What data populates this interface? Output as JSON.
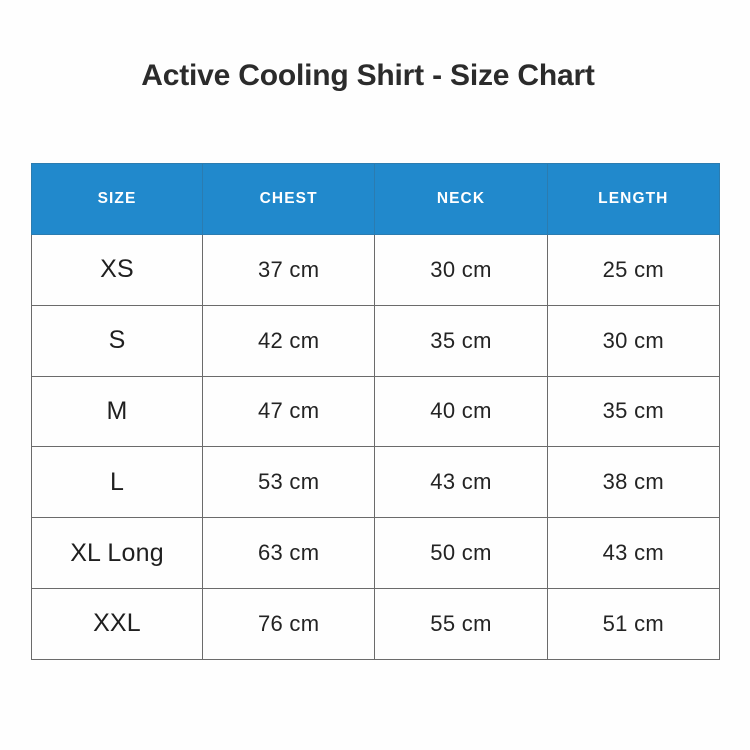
{
  "page": {
    "title": "Active Cooling Shirt - Size Chart",
    "background_color": "#fefefe",
    "accent_color": "#2189cc",
    "border_color": "#6b6b6b",
    "text_color": "#2b2b2b"
  },
  "chart_data": {
    "type": "table",
    "title": "Active Cooling Shirt - Size Chart",
    "columns": [
      "SIZE",
      "CHEST",
      "NECK",
      "LENGTH"
    ],
    "rows": [
      [
        "XS",
        "37 cm",
        "30 cm",
        "25 cm"
      ],
      [
        "S",
        "42 cm",
        "35 cm",
        "30 cm"
      ],
      [
        "M",
        "47 cm",
        "40 cm",
        "35 cm"
      ],
      [
        "L",
        "53 cm",
        "43 cm",
        "38 cm"
      ],
      [
        "XL Long",
        "63 cm",
        "50 cm",
        "43 cm"
      ],
      [
        "XXL",
        "76 cm",
        "55 cm",
        "51 cm"
      ]
    ],
    "unit": "cm",
    "series": [
      {
        "name": "CHEST",
        "values": [
          37,
          42,
          47,
          53,
          63,
          76
        ]
      },
      {
        "name": "NECK",
        "values": [
          30,
          35,
          40,
          43,
          50,
          55
        ]
      },
      {
        "name": "LENGTH",
        "values": [
          25,
          30,
          35,
          38,
          43,
          51
        ]
      }
    ],
    "categories": [
      "XS",
      "S",
      "M",
      "L",
      "XL Long",
      "XXL"
    ],
    "header_background": "#2189cc",
    "header_text_color": "#ffffff",
    "grid": true,
    "legend_position": "none"
  }
}
